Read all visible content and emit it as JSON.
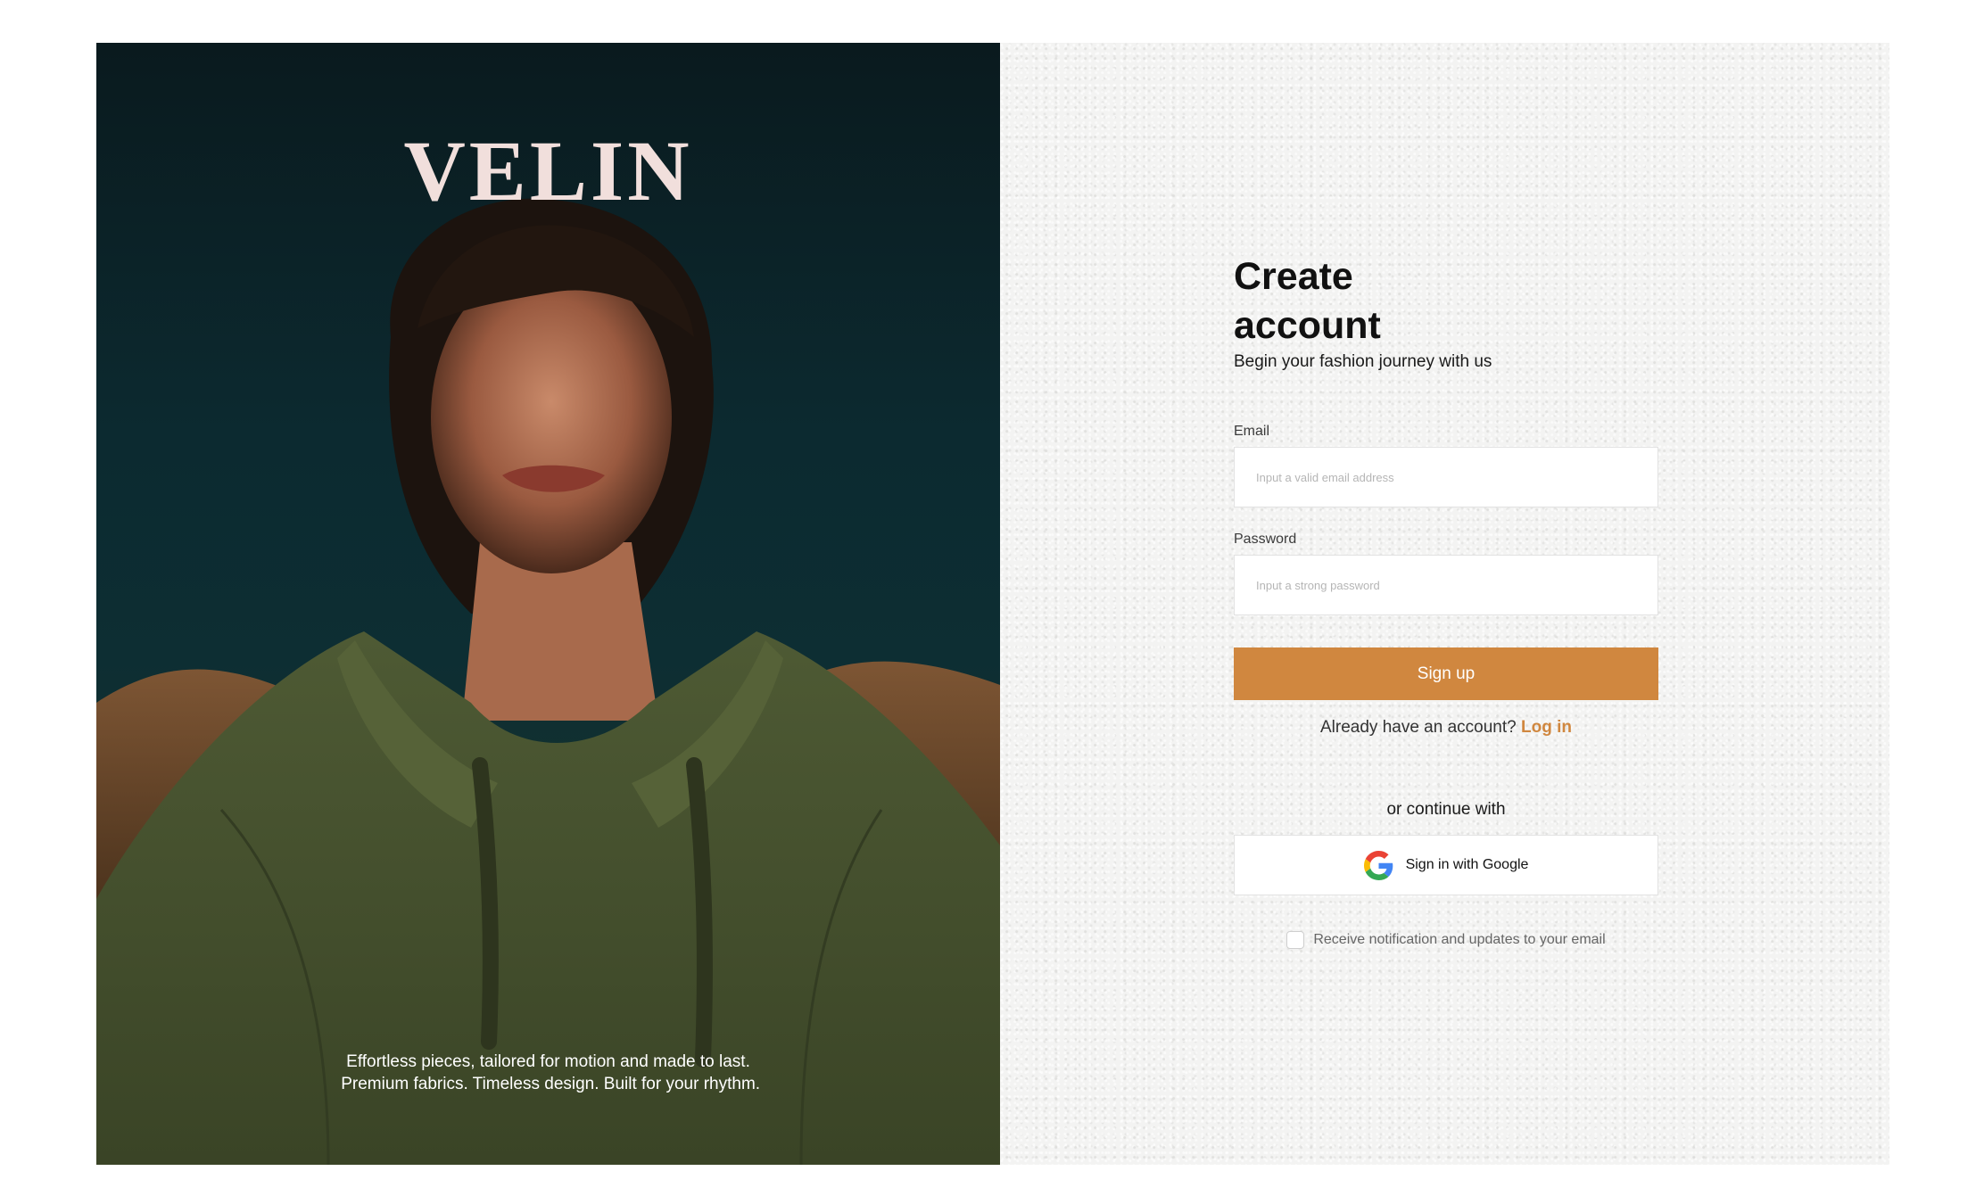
{
  "hero": {
    "brand": "VELIN",
    "tagline_line1": "Effortless pieces, tailored for motion and made to last.",
    "tagline_line2": " Premium fabrics. Timeless design. Built for your rhythm."
  },
  "form": {
    "title": "Create account",
    "subtitle": "Begin your fashion journey with us",
    "email": {
      "label": "Email",
      "value": "",
      "placeholder": "Input a valid email address"
    },
    "password": {
      "label": "Password",
      "value": "",
      "placeholder": "Input a strong password"
    },
    "signup_label": "Sign up",
    "login_prompt": "Already have an account?",
    "login_label": "Log in",
    "or_label": "or continue with",
    "google_label": "Sign in with Google",
    "notify_label": "Receive notification and updates to your email",
    "notify_checked": false
  },
  "colors": {
    "accent": "#d0873f",
    "brand_text": "#f1dfdc",
    "hero_bg": "#0d2e33",
    "panel_bg": "#f3f3f2"
  },
  "icons": {
    "google": "google-g-icon",
    "checkbox": "checkbox-unchecked"
  }
}
